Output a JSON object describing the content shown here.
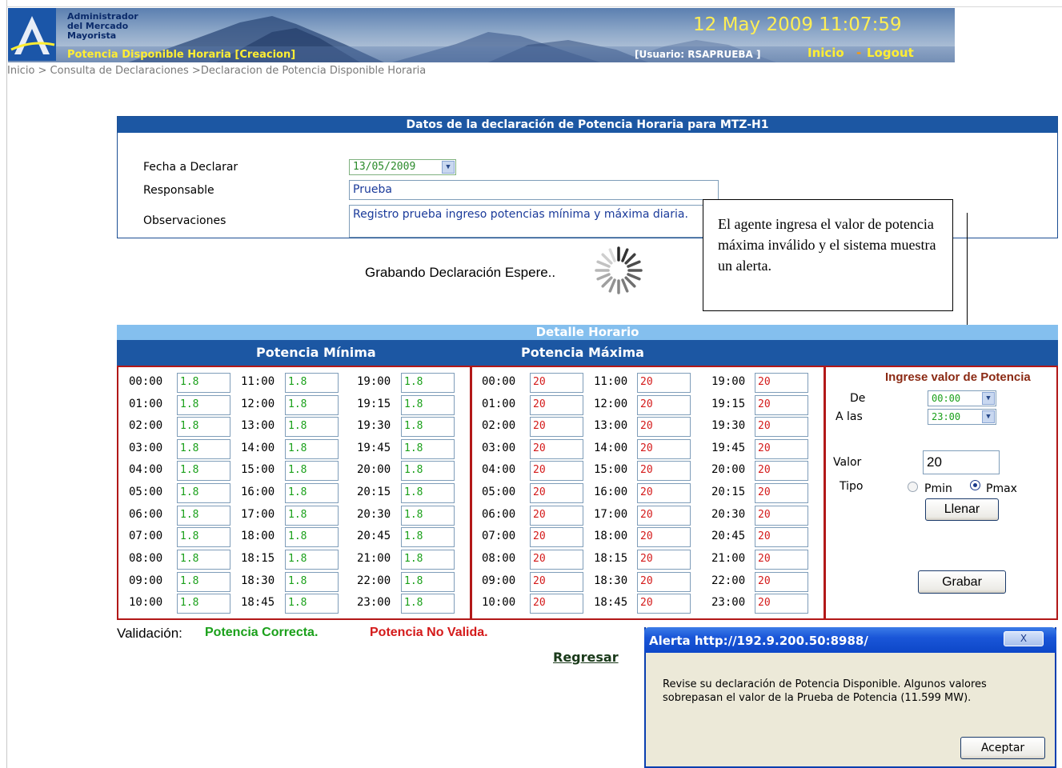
{
  "header": {
    "org_line1": "Administrador",
    "org_line2": "del Mercado",
    "org_line3": "Mayorista",
    "subtitle": "Potencia Disponible Horaria [Creacion]",
    "datetime": "12 May 2009 11:07:59",
    "user": "[Usuario: RSAPRUEBA ]",
    "inicio": "Inicio",
    "separator": "-",
    "logout": "Logout"
  },
  "breadcrumb": "Inicio > Consulta de Declaraciones >Declaracion de Potencia Disponible Horaria",
  "declaration": {
    "title": "Datos de la declaración de Potencia Horaria para MTZ-H1",
    "fecha_label": "Fecha a Declarar",
    "fecha_value": "13/05/2009",
    "responsable_label": "Responsable",
    "responsable_value": "Prueba",
    "observaciones_label": "Observaciones",
    "observaciones_value": "Registro prueba ingreso potencias mínima y máxima diaria."
  },
  "saving_message": "Grabando Declaración Espere..",
  "callout": "El agente ingresa el valor de potencia  máxima inválido y el sistema muestra un alerta.",
  "detail": {
    "title": "Detalle Horario",
    "min_header": "Potencia Mínima",
    "max_header": "Potencia Máxima",
    "min_columns": [
      {
        "times": [
          "00:00",
          "01:00",
          "02:00",
          "03:00",
          "04:00",
          "05:00",
          "06:00",
          "07:00",
          "08:00",
          "09:00",
          "10:00"
        ],
        "values": [
          "1.8",
          "1.8",
          "1.8",
          "1.8",
          "1.8",
          "1.8",
          "1.8",
          "1.8",
          "1.8",
          "1.8",
          "1.8"
        ]
      },
      {
        "times": [
          "11:00",
          "12:00",
          "13:00",
          "14:00",
          "15:00",
          "16:00",
          "17:00",
          "18:00",
          "18:15",
          "18:30",
          "18:45"
        ],
        "values": [
          "1.8",
          "1.8",
          "1.8",
          "1.8",
          "1.8",
          "1.8",
          "1.8",
          "1.8",
          "1.8",
          "1.8",
          "1.8"
        ]
      },
      {
        "times": [
          "19:00",
          "19:15",
          "19:30",
          "19:45",
          "20:00",
          "20:15",
          "20:30",
          "20:45",
          "21:00",
          "22:00",
          "23:00"
        ],
        "values": [
          "1.8",
          "1.8",
          "1.8",
          "1.8",
          "1.8",
          "1.8",
          "1.8",
          "1.8",
          "1.8",
          "1.8",
          "1.8"
        ]
      }
    ],
    "max_columns": [
      {
        "times": [
          "00:00",
          "01:00",
          "02:00",
          "03:00",
          "04:00",
          "05:00",
          "06:00",
          "07:00",
          "08:00",
          "09:00",
          "10:00"
        ],
        "values": [
          "20",
          "20",
          "20",
          "20",
          "20",
          "20",
          "20",
          "20",
          "20",
          "20",
          "20"
        ]
      },
      {
        "times": [
          "11:00",
          "12:00",
          "13:00",
          "14:00",
          "15:00",
          "16:00",
          "17:00",
          "18:00",
          "18:15",
          "18:30",
          "18:45"
        ],
        "values": [
          "20",
          "20",
          "20",
          "20",
          "20",
          "20",
          "20",
          "20",
          "20",
          "20",
          "20"
        ]
      },
      {
        "times": [
          "19:00",
          "19:15",
          "19:30",
          "19:45",
          "20:00",
          "20:15",
          "20:30",
          "20:45",
          "21:00",
          "22:00",
          "23:00"
        ],
        "values": [
          "20",
          "20",
          "20",
          "20",
          "20",
          "20",
          "20",
          "20",
          "20",
          "20",
          "20"
        ]
      }
    ]
  },
  "fill_panel": {
    "title": "Ingrese valor de Potencia",
    "de_label": "De",
    "de_value": "00:00",
    "alas_label": "A las",
    "alas_value": "23:00",
    "valor_label": "Valor",
    "valor_value": "20",
    "tipo_label": "Tipo",
    "pmin_label": "Pmin",
    "pmax_label": "Pmax",
    "selected_tipo": "Pmax",
    "llenar_label": "Llenar",
    "grabar_label": "Grabar"
  },
  "validation": {
    "label": "Validación:",
    "ok": "Potencia Correcta.",
    "bad": "Potencia No Valida."
  },
  "regresar": "Regresar",
  "dialog": {
    "title": "Alerta http://192.9.200.50:8988/",
    "close": "X",
    "message": "Revise su declaración de Potencia Disponible. Algunos valores sobrepasan el valor de la Prueba de Potencia (11.599 MW).",
    "ok_label": "Aceptar"
  }
}
